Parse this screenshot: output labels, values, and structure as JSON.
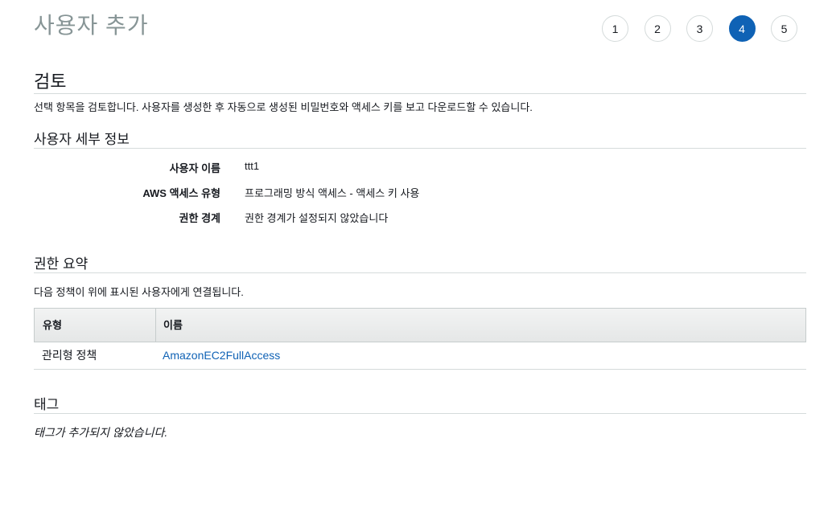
{
  "header": {
    "title": "사용자 추가",
    "steps": [
      "1",
      "2",
      "3",
      "4",
      "5"
    ],
    "active_step": "4",
    "accent_color": "#0f62b5"
  },
  "review": {
    "heading": "검토",
    "description": "선택 항목을 검토합니다. 사용자를 생성한 후 자동으로 생성된 비밀번호와 액세스 키를 보고 다운로드할 수 있습니다."
  },
  "user_details": {
    "heading": "사용자 세부 정보",
    "rows": [
      {
        "key": "사용자 이름",
        "value": "ttt1"
      },
      {
        "key": "AWS 액세스 유형",
        "value": "프로그래밍 방식 액세스 - 액세스 키 사용"
      },
      {
        "key": "권한 경계",
        "value": "권한 경계가 설정되지 않았습니다"
      }
    ]
  },
  "permissions": {
    "heading": "권한 요약",
    "description": "다음 정책이 위에 표시된 사용자에게 연결됩니다.",
    "columns": [
      "유형",
      "이름"
    ],
    "rows": [
      {
        "type": "관리형 정책",
        "name": "AmazonEC2FullAccess"
      }
    ]
  },
  "tags": {
    "heading": "태그",
    "empty_text": "태그가 추가되지 않았습니다."
  }
}
